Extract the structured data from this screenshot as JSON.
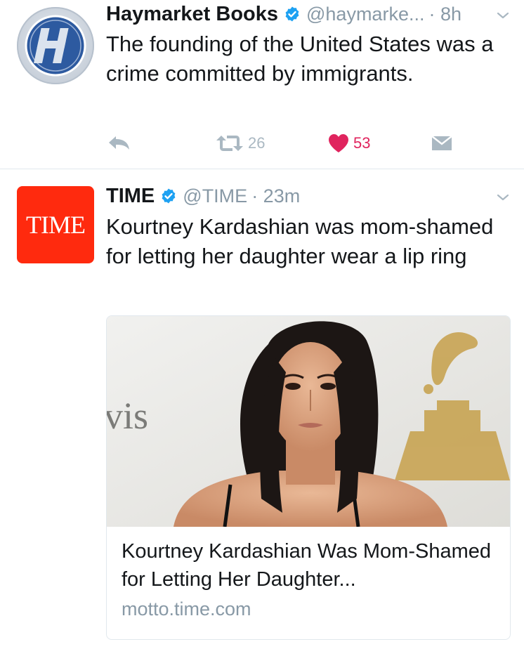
{
  "tweets": [
    {
      "name": "Haymarket Books",
      "handle": "@haymarke...",
      "time": "· 8h",
      "text": "The founding of the United States was a crime committed by immigrants.",
      "avatar_letter": "H",
      "actions": {
        "retweets": "26",
        "likes": "53"
      }
    },
    {
      "name": "TIME",
      "handle": "@TIME",
      "time": "· 23m",
      "text": "Kourtney Kardashian was mom-shamed for letting her daughter wear a lip ring",
      "avatar_text": "TIME",
      "card": {
        "title": "Kourtney Kardashian Was Mom-Shamed for Letting Her Daughter...",
        "domain": "motto.time.com",
        "image_caption_text": "vis"
      }
    }
  ],
  "icons": [
    "verified-badge-icon",
    "chevron-down-icon",
    "reply-icon",
    "retweet-icon",
    "heart-icon",
    "direct-message-icon"
  ],
  "colors": {
    "text": "#14171a",
    "muted": "#8899a6",
    "verified": "#1da1f2",
    "like": "#e0245e",
    "time_brand": "#ff2a0e",
    "divider": "#e1e8ed"
  }
}
